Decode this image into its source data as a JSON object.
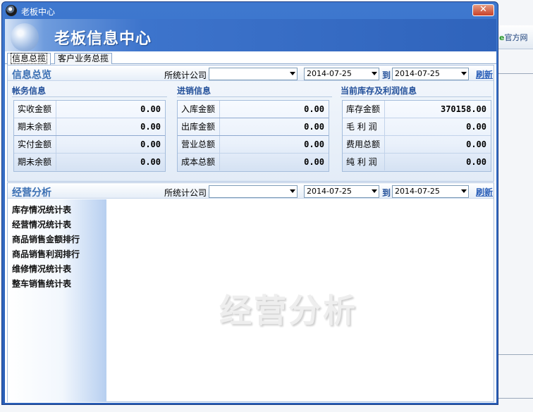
{
  "background": {
    "link_text": "官方网"
  },
  "window": {
    "title": "老板中心",
    "close_glyph": "✕"
  },
  "banner": {
    "title": "老板信息中心"
  },
  "tabs": [
    {
      "label": "信息总揽"
    },
    {
      "label": "客户业务总揽"
    }
  ],
  "info_panel": {
    "title": "信息总览",
    "filter_label": "所统计公司",
    "company_value": "",
    "date_from": "2014-07-25",
    "to_label": "到",
    "date_to": "2014-07-25",
    "refresh_label": "刷新",
    "groups": {
      "finance": {
        "title": "帐务信息",
        "rows": [
          {
            "label": "实收金额",
            "value": "0.00"
          },
          {
            "label": "期未余额",
            "value": "0.00"
          },
          {
            "label": "实付金额",
            "value": "0.00"
          },
          {
            "label": "期未余额",
            "value": "0.00"
          }
        ]
      },
      "purchase": {
        "title": "进销信息",
        "rows": [
          {
            "label": "入库金额",
            "value": "0.00"
          },
          {
            "label": "出库金额",
            "value": "0.00"
          },
          {
            "label": "营业总额",
            "value": "0.00"
          },
          {
            "label": "成本总额",
            "value": "0.00"
          }
        ]
      },
      "stock": {
        "title": "当前库存及利润信息",
        "rows": [
          {
            "label": "库存金额",
            "value": "370158.00"
          },
          {
            "label": "毛 利 润",
            "value": "0.00"
          },
          {
            "label": "费用总额",
            "value": "0.00"
          },
          {
            "label": "纯 利 润",
            "value": "0.00"
          }
        ]
      }
    }
  },
  "analysis_panel": {
    "title": "经营分析",
    "filter_label": "所统计公司",
    "company_value": "",
    "date_from": "2014-07-25",
    "to_label": "到",
    "date_to": "2014-07-25",
    "refresh_label": "刷新",
    "reports": [
      "库存情况统计表",
      "经营情况统计表",
      "商品销售金额排行",
      "商品销售利润排行",
      "维修情况统计表",
      "整车销售统计表"
    ],
    "watermark": "经营分析"
  }
}
